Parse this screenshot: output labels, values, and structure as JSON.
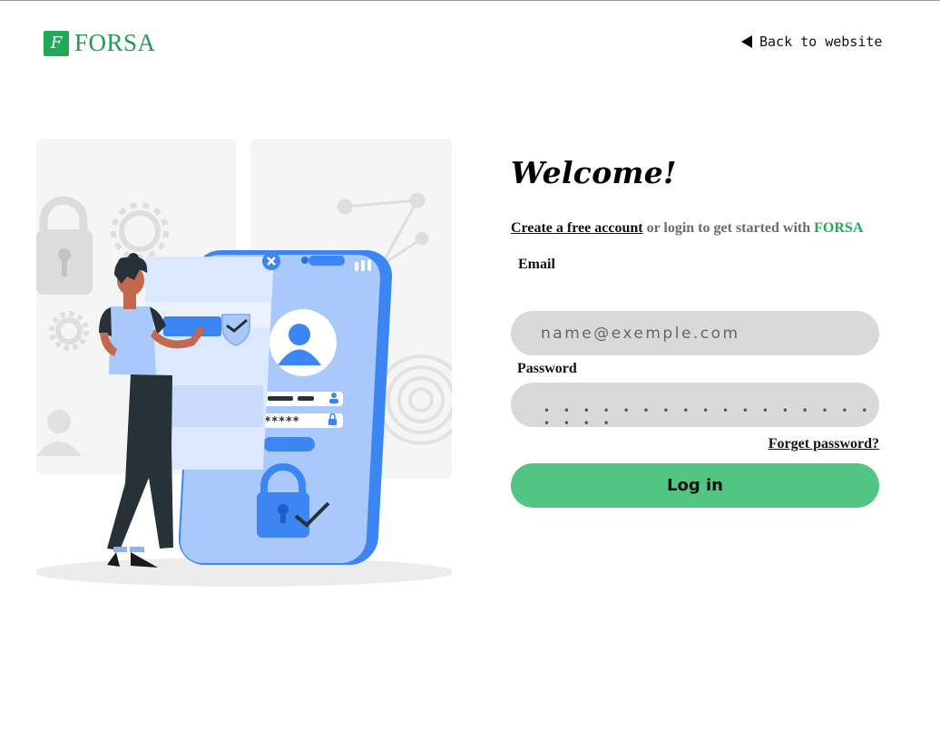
{
  "header": {
    "logo_mark": "F",
    "logo_text": "FORSA",
    "back_label": "Back to website"
  },
  "illustration": {
    "icon": "login-security-illustration",
    "field_mask": "*****"
  },
  "login": {
    "title": "Welcome!",
    "create_account": "Create a free account",
    "subtitle_middle": " or login to get started with ",
    "brand": "FORSA",
    "email_label": "Email",
    "email_placeholder": "name@exemple.com",
    "password_label": "Password",
    "password_mask": "• • • • • • • • • • • • • • • • • • • • •",
    "forget_password": "Forget password?",
    "login_button": "Log in"
  },
  "colors": {
    "brand_green": "#1faa55",
    "button_green": "#52c483",
    "field_gray": "#d9d9d9",
    "illustration_blue": "#a9c8fb",
    "illustration_dark_blue": "#3b86f2"
  }
}
